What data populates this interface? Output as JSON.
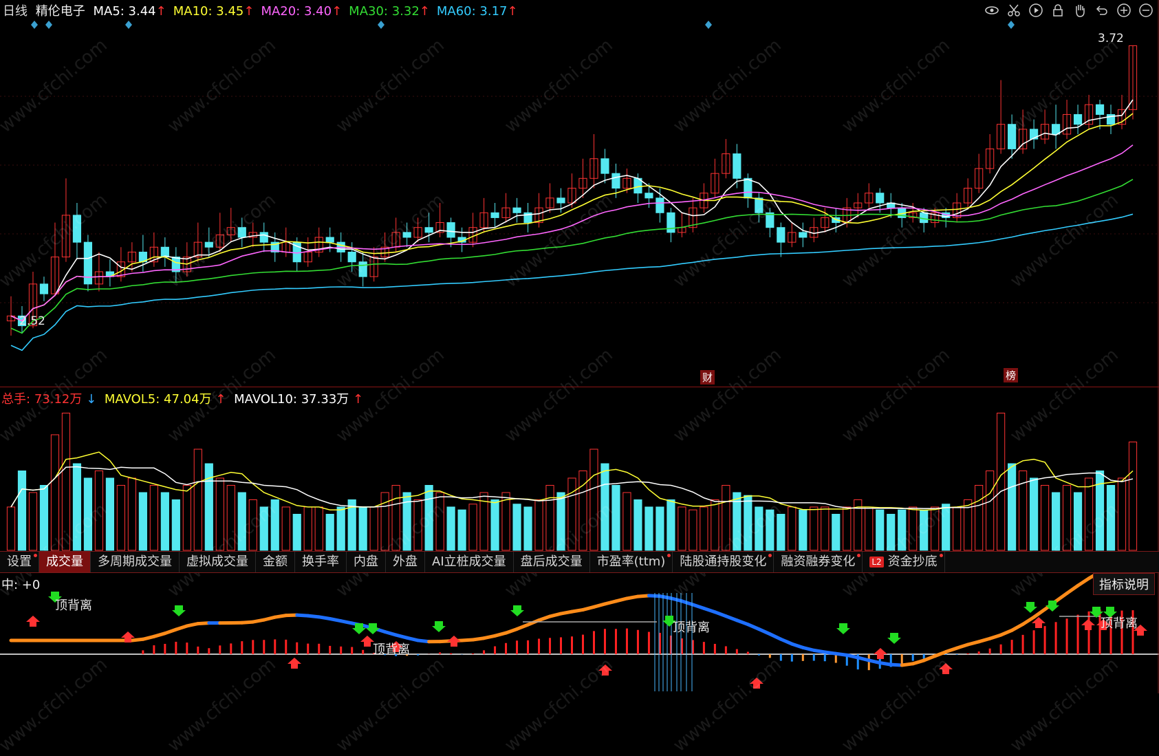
{
  "header": {
    "period": "日线",
    "stock_name": "精伦电子",
    "ma": [
      {
        "label": "MA5:",
        "value": "3.44",
        "arrow": "↑",
        "color": "#ffffff"
      },
      {
        "label": "MA10:",
        "value": "3.45",
        "arrow": "↑",
        "color": "#ffff33"
      },
      {
        "label": "MA20:",
        "value": "3.40",
        "arrow": "↑",
        "color": "#ff66ff"
      },
      {
        "label": "MA30:",
        "value": "3.32",
        "arrow": "↑",
        "color": "#33dd33"
      },
      {
        "label": "MA60:",
        "value": "3.17",
        "arrow": "↑",
        "color": "#33ccff"
      }
    ]
  },
  "toolbar_icons": [
    "eye-icon",
    "scissors-icon",
    "play-icon",
    "lock-icon",
    "hand-icon",
    "undo-icon",
    "zoom-in-icon",
    "zoom-out-icon"
  ],
  "price_panel": {
    "high_label": "3.72",
    "low_label": "2.52",
    "tag_cai": "财",
    "tag_bang": "榜"
  },
  "volume_panel": {
    "total_label": "总手:",
    "total_value": "73.12万",
    "total_arrow": "↓",
    "mavol5_label": "MAVOL5:",
    "mavol5_value": "47.04万",
    "mavol5_arrow": "↑",
    "mavol10_label": "MAVOL10:",
    "mavol10_value": "37.33万",
    "mavol10_arrow": "↑"
  },
  "tabs": [
    {
      "label": "设置",
      "dot": true,
      "active": false
    },
    {
      "label": "成交量",
      "dot": false,
      "active": true
    },
    {
      "label": "多周期成交量",
      "dot": false,
      "active": false
    },
    {
      "label": "虚拟成交量",
      "dot": false,
      "active": false
    },
    {
      "label": "金额",
      "dot": false,
      "active": false
    },
    {
      "label": "换手率",
      "dot": false,
      "active": false
    },
    {
      "label": "内盘",
      "dot": false,
      "active": false
    },
    {
      "label": "外盘",
      "dot": false,
      "active": false
    },
    {
      "label": "AI立桩成交量",
      "dot": false,
      "active": false
    },
    {
      "label": "盘后成交量",
      "dot": false,
      "active": false
    },
    {
      "label": "市盈率(ttm)",
      "dot": true,
      "active": false
    },
    {
      "label": "陆股通持股变化",
      "dot": true,
      "active": false
    },
    {
      "label": "融资融券变化",
      "dot": true,
      "active": false
    },
    {
      "label": "资金抄底",
      "dot": true,
      "active": false,
      "badge": "L2"
    }
  ],
  "indicator_panel": {
    "label": "中: +0",
    "button": "指标说明",
    "divergence_labels": [
      "顶背离",
      "顶背离",
      "顶背离",
      "顶背离"
    ]
  },
  "watermark": "www.cfchi.com",
  "colors": {
    "up": "#ff3333",
    "down": "#55e8f0",
    "ma5": "#ffffff",
    "ma10": "#ffff33",
    "ma20": "#ff66ff",
    "ma30": "#33dd33",
    "ma60": "#33ccff",
    "macd_blue": "#1e6fff",
    "macd_orange": "#ff8c1a"
  },
  "chart_data": {
    "type": "candlestick",
    "price_range": [
      2.52,
      3.72
    ],
    "candles": [
      [
        2.6,
        2.62,
        2.54,
        2.7
      ],
      [
        2.62,
        2.58,
        2.55,
        2.66
      ],
      [
        2.58,
        2.75,
        2.57,
        2.8
      ],
      [
        2.75,
        2.71,
        2.68,
        2.78
      ],
      [
        2.71,
        2.86,
        2.7,
        3.0
      ],
      [
        2.86,
        3.03,
        2.84,
        3.18
      ],
      [
        3.03,
        2.92,
        2.85,
        3.08
      ],
      [
        2.92,
        2.75,
        2.72,
        2.95
      ],
      [
        2.75,
        2.8,
        2.72,
        2.88
      ],
      [
        2.8,
        2.78,
        2.74,
        2.85
      ],
      [
        2.78,
        2.84,
        2.76,
        2.9
      ],
      [
        2.84,
        2.88,
        2.8,
        2.92
      ],
      [
        2.88,
        2.84,
        2.8,
        2.95
      ],
      [
        2.84,
        2.9,
        2.82,
        2.96
      ],
      [
        2.9,
        2.86,
        2.82,
        2.94
      ],
      [
        2.86,
        2.8,
        2.76,
        2.9
      ],
      [
        2.8,
        2.86,
        2.78,
        2.92
      ],
      [
        2.86,
        2.92,
        2.84,
        3.0
      ],
      [
        2.92,
        2.9,
        2.86,
        2.98
      ],
      [
        2.9,
        2.95,
        2.88,
        3.04
      ],
      [
        2.95,
        2.98,
        2.92,
        3.06
      ],
      [
        2.98,
        2.94,
        2.9,
        3.02
      ],
      [
        2.94,
        2.96,
        2.9,
        3.0
      ],
      [
        2.96,
        2.92,
        2.88,
        3.0
      ],
      [
        2.92,
        2.88,
        2.84,
        2.96
      ],
      [
        2.88,
        2.92,
        2.86,
        2.98
      ],
      [
        2.92,
        2.84,
        2.8,
        2.94
      ],
      [
        2.84,
        2.88,
        2.82,
        2.94
      ],
      [
        2.88,
        2.94,
        2.86,
        2.98
      ],
      [
        2.94,
        2.92,
        2.88,
        2.98
      ],
      [
        2.92,
        2.88,
        2.84,
        2.96
      ],
      [
        2.88,
        2.84,
        2.8,
        2.92
      ],
      [
        2.84,
        2.78,
        2.74,
        2.88
      ],
      [
        2.78,
        2.86,
        2.76,
        2.9
      ],
      [
        2.86,
        2.9,
        2.84,
        2.96
      ],
      [
        2.9,
        2.96,
        2.88,
        3.02
      ],
      [
        2.96,
        2.94,
        2.9,
        3.0
      ],
      [
        2.94,
        2.98,
        2.92,
        3.02
      ],
      [
        2.98,
        2.96,
        2.92,
        3.04
      ],
      [
        2.96,
        3.0,
        2.94,
        3.08
      ],
      [
        3.0,
        2.94,
        2.9,
        3.02
      ],
      [
        2.94,
        2.92,
        2.88,
        2.98
      ],
      [
        2.92,
        2.98,
        2.9,
        3.04
      ],
      [
        2.98,
        3.04,
        2.96,
        3.1
      ],
      [
        3.04,
        3.02,
        2.98,
        3.08
      ],
      [
        3.02,
        3.06,
        3.0,
        3.12
      ],
      [
        3.06,
        3.04,
        3.0,
        3.1
      ],
      [
        3.04,
        3.0,
        2.96,
        3.08
      ],
      [
        3.0,
        3.06,
        2.98,
        3.12
      ],
      [
        3.06,
        3.1,
        3.04,
        3.16
      ],
      [
        3.1,
        3.08,
        3.04,
        3.14
      ],
      [
        3.08,
        3.14,
        3.06,
        3.2
      ],
      [
        3.14,
        3.18,
        3.1,
        3.26
      ],
      [
        3.18,
        3.26,
        3.14,
        3.36
      ],
      [
        3.26,
        3.2,
        3.16,
        3.3
      ],
      [
        3.2,
        3.14,
        3.1,
        3.24
      ],
      [
        3.14,
        3.18,
        3.12,
        3.22
      ],
      [
        3.18,
        3.12,
        3.08,
        3.2
      ],
      [
        3.12,
        3.1,
        3.06,
        3.16
      ],
      [
        3.1,
        3.04,
        3.0,
        3.14
      ],
      [
        3.04,
        2.96,
        2.92,
        3.06
      ],
      [
        2.96,
        2.98,
        2.94,
        3.04
      ],
      [
        2.98,
        3.06,
        2.96,
        3.1
      ],
      [
        3.06,
        3.12,
        3.04,
        3.16
      ],
      [
        3.12,
        3.2,
        3.1,
        3.26
      ],
      [
        3.2,
        3.28,
        3.18,
        3.34
      ],
      [
        3.28,
        3.18,
        3.14,
        3.32
      ],
      [
        3.18,
        3.1,
        3.06,
        3.2
      ],
      [
        3.1,
        3.04,
        3.0,
        3.12
      ],
      [
        3.04,
        2.98,
        2.94,
        3.06
      ],
      [
        2.98,
        2.92,
        2.86,
        3.0
      ],
      [
        2.92,
        2.96,
        2.9,
        3.0
      ],
      [
        2.96,
        2.94,
        2.9,
        3.0
      ],
      [
        2.94,
        2.98,
        2.92,
        3.02
      ],
      [
        2.98,
        3.02,
        2.96,
        3.06
      ],
      [
        3.02,
        3.0,
        2.96,
        3.06
      ],
      [
        3.0,
        3.06,
        2.98,
        3.1
      ],
      [
        3.06,
        3.08,
        3.02,
        3.12
      ],
      [
        3.08,
        3.12,
        3.06,
        3.16
      ],
      [
        3.12,
        3.08,
        3.04,
        3.14
      ],
      [
        3.08,
        3.06,
        3.02,
        3.12
      ],
      [
        3.06,
        3.02,
        2.98,
        3.08
      ],
      [
        3.02,
        3.04,
        3.0,
        3.08
      ],
      [
        3.04,
        3.0,
        2.96,
        3.06
      ],
      [
        3.0,
        3.04,
        2.98,
        3.06
      ],
      [
        3.04,
        3.02,
        2.98,
        3.06
      ],
      [
        3.02,
        3.08,
        3.0,
        3.12
      ],
      [
        3.08,
        3.14,
        3.06,
        3.18
      ],
      [
        3.14,
        3.22,
        3.12,
        3.28
      ],
      [
        3.22,
        3.3,
        3.2,
        3.36
      ],
      [
        3.3,
        3.4,
        3.28,
        3.58
      ],
      [
        3.4,
        3.3,
        3.26,
        3.44
      ],
      [
        3.3,
        3.38,
        3.28,
        3.46
      ],
      [
        3.38,
        3.34,
        3.3,
        3.42
      ],
      [
        3.34,
        3.4,
        3.32,
        3.46
      ],
      [
        3.4,
        3.36,
        3.3,
        3.48
      ],
      [
        3.36,
        3.44,
        3.34,
        3.5
      ],
      [
        3.44,
        3.4,
        3.36,
        3.48
      ],
      [
        3.4,
        3.48,
        3.38,
        3.52
      ],
      [
        3.48,
        3.44,
        3.38,
        3.5
      ],
      [
        3.44,
        3.4,
        3.36,
        3.48
      ],
      [
        3.4,
        3.46,
        3.38,
        3.52
      ],
      [
        3.46,
        3.72,
        3.42,
        3.72
      ]
    ],
    "volume": [
      30,
      55,
      40,
      45,
      80,
      95,
      60,
      50,
      55,
      50,
      45,
      50,
      40,
      45,
      40,
      35,
      45,
      70,
      60,
      50,
      45,
      40,
      35,
      30,
      35,
      30,
      25,
      30,
      30,
      25,
      30,
      35,
      30,
      30,
      40,
      45,
      40,
      35,
      45,
      40,
      30,
      28,
      32,
      40,
      35,
      40,
      32,
      30,
      35,
      45,
      40,
      50,
      55,
      70,
      60,
      45,
      40,
      35,
      30,
      30,
      35,
      30,
      28,
      30,
      35,
      45,
      40,
      38,
      30,
      28,
      25,
      30,
      28,
      30,
      30,
      25,
      30,
      35,
      30,
      28,
      25,
      28,
      30,
      28,
      30,
      32,
      30,
      35,
      45,
      55,
      95,
      60,
      55,
      50,
      45,
      40,
      45,
      40,
      50,
      55,
      45,
      50,
      75
    ]
  }
}
